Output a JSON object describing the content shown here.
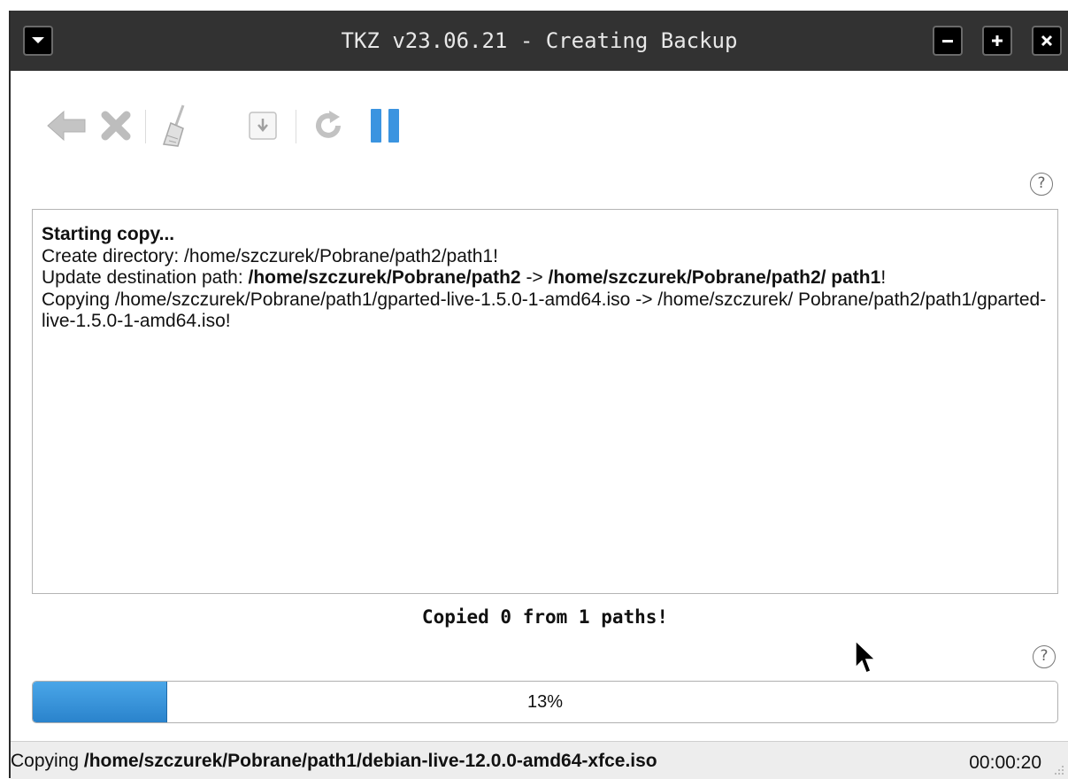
{
  "window": {
    "title": "TKZ v23.06.21 - Creating Backup",
    "buttons": {
      "minimize": "−",
      "maximize": "+",
      "close": "×"
    }
  },
  "toolbar": {
    "icons": [
      "back-arrow-icon",
      "cancel-icon",
      "broom-clean-icon",
      "download-icon",
      "refresh-icon",
      "pause-icon"
    ]
  },
  "log": {
    "line1": "Starting copy...",
    "line2": "Create directory: /home/szczurek/Pobrane/path2/path1!",
    "line3_prefix": "Update destination path: ",
    "line3_src": "/home/szczurek/Pobrane/path2",
    "line3_arrow": " -> ",
    "line3_dst": "/home/szczurek/Pobrane/path2/ path1",
    "line3_suffix": "!",
    "line4": "Copying /home/szczurek/Pobrane/path1/gparted-live-1.5.0-1-amd64.iso -> /home/szczurek/ Pobrane/path2/path1/gparted-live-1.5.0-1-amd64.iso!"
  },
  "summary": "Copied 0 from 1 paths!",
  "progress": {
    "value": 13,
    "label": "13%"
  },
  "help_label": "?",
  "status": {
    "prefix": "Copying ",
    "path": "/home/szczurek/Pobrane/path1/debian-live-12.0.0-amd64-xfce.iso",
    "elapsed": "00:00:20"
  },
  "colors": {
    "accent": "#2a83cc",
    "titlebar": "#323232"
  }
}
